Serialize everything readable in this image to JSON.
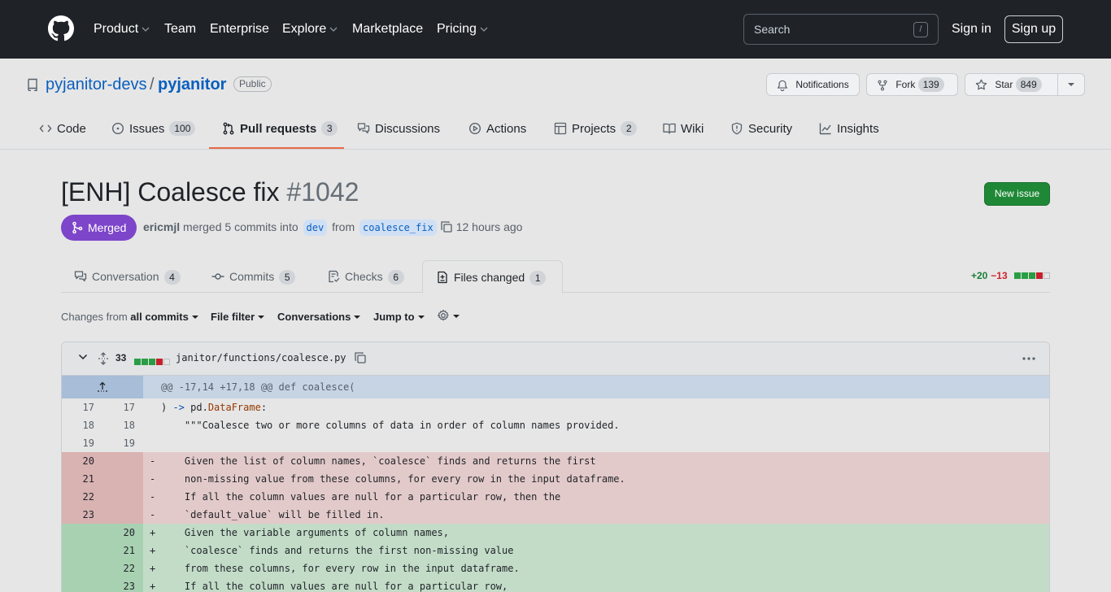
{
  "header": {
    "nav": [
      {
        "label": "Product",
        "dropdown": true
      },
      {
        "label": "Team",
        "dropdown": false
      },
      {
        "label": "Enterprise",
        "dropdown": false
      },
      {
        "label": "Explore",
        "dropdown": true
      },
      {
        "label": "Marketplace",
        "dropdown": false
      },
      {
        "label": "Pricing",
        "dropdown": true
      }
    ],
    "search_placeholder": "Search",
    "search_shortcut": "/",
    "sign_in": "Sign in",
    "sign_up": "Sign up"
  },
  "repo": {
    "owner": "pyjanitor-devs",
    "separator": "/",
    "name": "pyjanitor",
    "visibility": "Public",
    "notifications_label": "Notifications",
    "fork_label": "Fork",
    "fork_count": "139",
    "star_label": "Star",
    "star_count": "849"
  },
  "repo_tabs": [
    {
      "label": "Code",
      "icon": "code-icon",
      "count": ""
    },
    {
      "label": "Issues",
      "icon": "issue-icon",
      "count": "100"
    },
    {
      "label": "Pull requests",
      "icon": "pull-request-icon",
      "count": "3",
      "active": true
    },
    {
      "label": "Discussions",
      "icon": "discussion-icon",
      "count": ""
    },
    {
      "label": "Actions",
      "icon": "play-icon",
      "count": ""
    },
    {
      "label": "Projects",
      "icon": "table-icon",
      "count": "2"
    },
    {
      "label": "Wiki",
      "icon": "book-icon",
      "count": ""
    },
    {
      "label": "Security",
      "icon": "shield-icon",
      "count": ""
    },
    {
      "label": "Insights",
      "icon": "graph-icon",
      "count": ""
    }
  ],
  "pr": {
    "title": "[ENH] Coalesce fix",
    "number": "#1042",
    "new_issue": "New issue",
    "state": "Merged",
    "author": "ericmjl",
    "meta_action": "merged 5 commits into",
    "base_branch": "dev",
    "meta_from": "from",
    "head_branch": "coalesce_fix",
    "time": "12 hours ago"
  },
  "pr_tabs": [
    {
      "label": "Conversation",
      "count": "4"
    },
    {
      "label": "Commits",
      "count": "5"
    },
    {
      "label": "Checks",
      "count": "6"
    },
    {
      "label": "Files changed",
      "count": "1"
    }
  ],
  "diffstat": {
    "additions": "+20",
    "deletions": "−13"
  },
  "toolbar": {
    "changes_from_prefix": "Changes from",
    "changes_from_value": "all commits",
    "file_filter": "File filter",
    "conversations": "Conversations",
    "jump_to": "Jump to"
  },
  "file": {
    "changes": "33",
    "path": "janitor/functions/coalesce.py",
    "hunk": "@@ -17,14 +17,18 @@ def coalesce(",
    "rows": [
      {
        "type": "ctx",
        "old": "17",
        "new": "17",
        "sign": "",
        "code": ") -> pd.DataFrame:"
      },
      {
        "type": "ctx",
        "old": "18",
        "new": "18",
        "sign": "",
        "code": "    \"\"\"Coalesce two or more columns of data in order of column names provided."
      },
      {
        "type": "ctx",
        "old": "19",
        "new": "19",
        "sign": "",
        "code": ""
      },
      {
        "type": "del",
        "old": "20",
        "new": "",
        "sign": "-",
        "code": "    Given the list of column names, `coalesce` finds and returns the first"
      },
      {
        "type": "del",
        "old": "21",
        "new": "",
        "sign": "-",
        "code": "    non-missing value from these columns, for every row in the input dataframe."
      },
      {
        "type": "del",
        "old": "22",
        "new": "",
        "sign": "-",
        "code": "    If all the column values are null for a particular row, then the"
      },
      {
        "type": "del",
        "old": "23",
        "new": "",
        "sign": "-",
        "code": "    `default_value` will be filled in."
      },
      {
        "type": "add",
        "old": "",
        "new": "20",
        "sign": "+",
        "code": "    Given the variable arguments of column names,"
      },
      {
        "type": "add",
        "old": "",
        "new": "21",
        "sign": "+",
        "code": "    `coalesce` finds and returns the first non-missing value"
      },
      {
        "type": "add",
        "old": "",
        "new": "22",
        "sign": "+",
        "code": "    from these columns, for every row in the input dataframe."
      },
      {
        "type": "add",
        "old": "",
        "new": "23",
        "sign": "+",
        "code": "    If all the column values are null for a particular row,"
      }
    ]
  },
  "colors": {
    "header_bg": "#1f2327",
    "link": "#0a5fbf",
    "merged": "#7d45c9",
    "active_tab": "#e66a45",
    "add_bg": "#c3dcc8",
    "del_bg": "#e3caca"
  }
}
